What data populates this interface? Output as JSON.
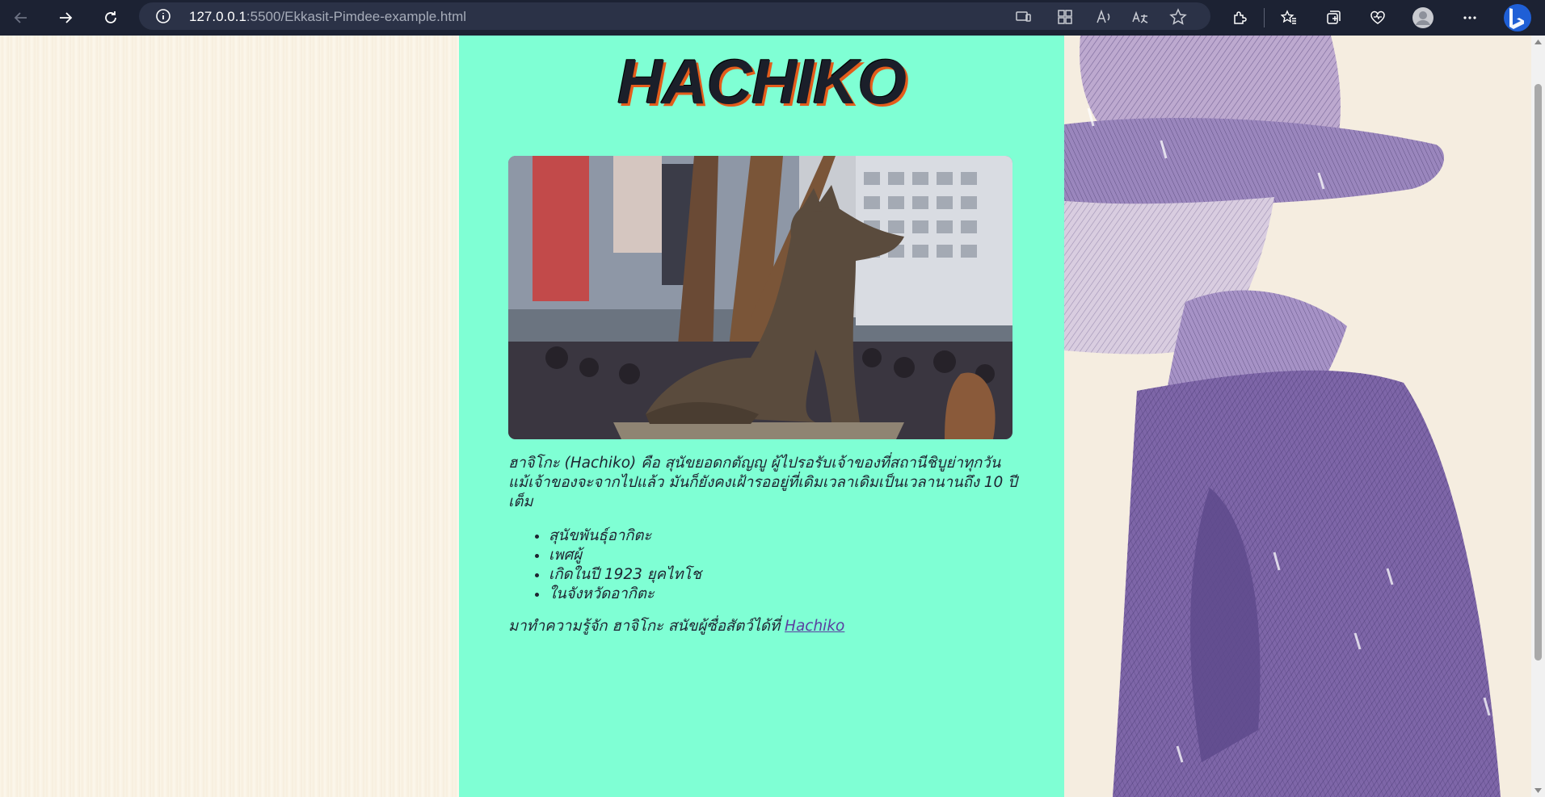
{
  "browser": {
    "url_host": "127.0.0.1",
    "url_rest": ":5500/Ekkasit-Pimdee-example.html"
  },
  "page": {
    "logo_text": "HACHIKO",
    "description": "ฮาจิโกะ (Hachiko) คือ สุนัขยอดกตัญญู ผู้ไปรอรับเจ้าของที่สถานีชิบูย่าทุกวัน แม้เจ้าของจะจากไปแล้ว มันก็ยังคงเฝ้ารออยู่ที่เดิมเวลาเดิมเป็นเวลานานถึง 10 ปีเต็ม",
    "facts": [
      "สุนัขพันธุ์อากิตะ",
      "เพศผู้",
      "เกิดในปี 1923 ยุคไทโช",
      "ในจังหวัดอากิตะ"
    ],
    "outro_text": "มาทำความรู้จัก ฮาจิโกะ สนัขผู้ซื่อสัตว์ได้ที่ ",
    "outro_link": "Hachiko"
  },
  "colors": {
    "main_bg": "#7fffd4",
    "toolbar_bg": "#1c2233",
    "logo_shadow": "#e35c1b",
    "link": "#5b3fa0"
  },
  "icons": [
    "back-icon",
    "forward-icon",
    "refresh-icon",
    "info-icon",
    "device-icon",
    "apps-icon",
    "read-aloud-icon",
    "translate-icon",
    "favorite-star-icon",
    "extensions-icon",
    "favorites-icon",
    "collections-icon",
    "browser-essentials-icon",
    "profile-icon",
    "more-icon",
    "bing-icon"
  ]
}
